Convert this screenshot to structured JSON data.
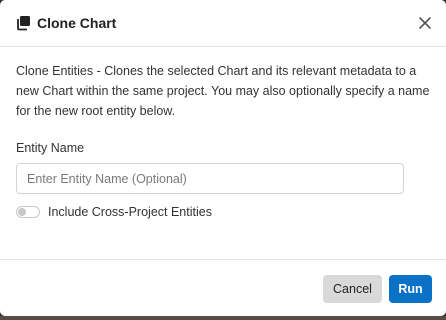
{
  "dialog": {
    "title": "Clone Chart",
    "title_icon": "clone-icon",
    "close_icon": "close-icon"
  },
  "body": {
    "description": "Clone Entities  -  Clones the selected Chart and its relevant metadata to a new Chart within the same project. You may also optionally specify a name for the new root entity below.",
    "entity_name_label": "Entity Name",
    "entity_name_value": "",
    "entity_name_placeholder": "Enter Entity Name (Optional)",
    "cross_project_label": "Include Cross-Project Entities",
    "cross_project_enabled": false
  },
  "footer": {
    "cancel_label": "Cancel",
    "run_label": "Run"
  },
  "colors": {
    "primary": "#0a72c6",
    "secondary_button": "#d9d9d9"
  }
}
